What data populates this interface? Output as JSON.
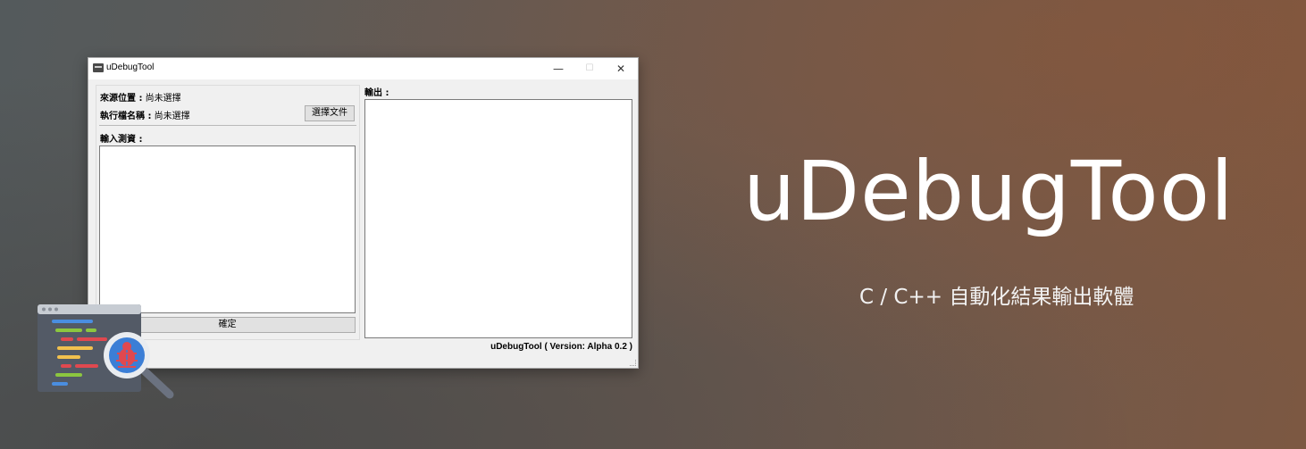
{
  "window": {
    "title": "uDebugTool",
    "controls": {
      "minimize": "—",
      "maximize": "☐",
      "close": "✕"
    }
  },
  "left_panel": {
    "source_label": "來源位置 :",
    "source_value": "尚未選擇",
    "exe_label": "執行檔名稱 :",
    "exe_value": "尚未選擇",
    "choose_file_button": "選擇文件",
    "input_label": "輸入測資 :",
    "input_value": "",
    "confirm_button": "確定"
  },
  "right_panel": {
    "output_label": "輸出 :",
    "output_value": ""
  },
  "status": {
    "version_text": "uDebugTool ( Version: Alpha 0.2 )"
  },
  "hero": {
    "title": "uDebugTool",
    "subtitle": "C / C++ 自動化結果輸出軟體"
  },
  "icons": {
    "app": "app-window-icon",
    "illustration": "code-bug-magnifier-icon"
  },
  "colors": {
    "bug_red": "#e0484f",
    "magnifier_blue": "#3b7ed6",
    "code_blue": "#4a8ee0",
    "code_green": "#8cc63f",
    "code_yellow": "#f2c14e"
  }
}
